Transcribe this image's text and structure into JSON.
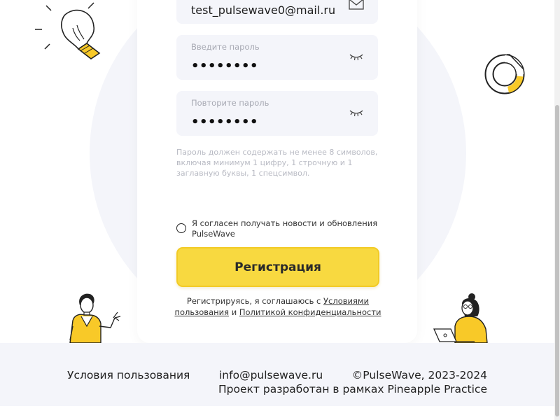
{
  "form": {
    "email_value": "test_pulsewave0@mail.ru",
    "password_label": "Введите пароль",
    "password_value": "••••••••",
    "repeat_label": "Повторите пароль",
    "repeat_value": "••••••••",
    "hint": "Пароль должен содержать не менее 8 символов, включая минимум 1 цифру, 1 строчную и 1 заглавную буквы, 1 спецсимвол.",
    "newsletter_label": "Я согласен получать новости и обновления PulseWave",
    "submit_label": "Регистрация",
    "terms_prefix": "Регистрируясь, я соглашаюсь с",
    "terms_link": "Условиями пользования",
    "terms_and": "и",
    "privacy_link": "Политикой конфиденциальности"
  },
  "footer": {
    "terms": "Условия пользования",
    "email": "info@pulsewave.ru",
    "copyright": "©PulseWave, 2023-2024",
    "project": "Проект разработан в рамках Pineapple Practice"
  },
  "colors": {
    "accent": "#f8d940",
    "background": "#f4f5fa",
    "hint": "#b8bac3"
  },
  "icons": [
    "mail-icon",
    "eye-closed-icon",
    "lightbulb-icon",
    "donut-chart-icon",
    "man-illustration",
    "woman-laptop-illustration"
  ]
}
